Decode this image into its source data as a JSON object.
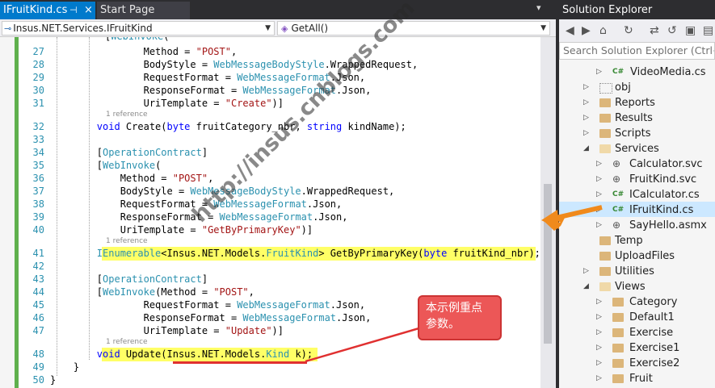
{
  "tabs": [
    {
      "label": "IFruitKind.cs",
      "active": true
    },
    {
      "label": "Start Page",
      "active": false
    }
  ],
  "nav": {
    "left_combo": "Insus.NET.Services.IFruitKind",
    "right_combo": "GetAll()"
  },
  "code_lines": [
    {
      "n": "27"
    },
    {
      "n": "28"
    },
    {
      "n": "29"
    },
    {
      "n": "30"
    },
    {
      "n": "31"
    },
    {
      "n": "32"
    },
    {
      "n": "33"
    },
    {
      "n": "34"
    },
    {
      "n": "35"
    },
    {
      "n": "36"
    },
    {
      "n": "37"
    },
    {
      "n": "38"
    },
    {
      "n": "39"
    },
    {
      "n": "40"
    },
    {
      "n": "41"
    },
    {
      "n": "42"
    },
    {
      "n": "43"
    },
    {
      "n": "44"
    },
    {
      "n": "45"
    },
    {
      "n": "46"
    },
    {
      "n": "47"
    },
    {
      "n": "48"
    },
    {
      "n": "49"
    },
    {
      "n": "50"
    }
  ],
  "reference_label": "1 reference",
  "solution_explorer": {
    "title": "Solution Explorer",
    "search_placeholder": "Search Solution Explorer (Ctrl+;)",
    "items": [
      {
        "label": "VideoMedia.cs"
      },
      {
        "label": "obj"
      },
      {
        "label": "Reports"
      },
      {
        "label": "Results"
      },
      {
        "label": "Scripts"
      },
      {
        "label": "Services"
      },
      {
        "label": "Calculator.svc"
      },
      {
        "label": "FruitKind.svc"
      },
      {
        "label": "ICalculator.cs"
      },
      {
        "label": "IFruitKind.cs"
      },
      {
        "label": "SayHello.asmx"
      },
      {
        "label": "Temp"
      },
      {
        "label": "UploadFiles"
      },
      {
        "label": "Utilities"
      },
      {
        "label": "Views"
      },
      {
        "label": "Category"
      },
      {
        "label": "Default1"
      },
      {
        "label": "Exercise"
      },
      {
        "label": "Exercise1"
      },
      {
        "label": "Exercise2"
      },
      {
        "label": "Fruit"
      }
    ]
  },
  "annotation": {
    "callout_line1": "本示例重点",
    "callout_line2": "参数。"
  },
  "watermark": "http://insus.cnblogs.com",
  "colors": {
    "accent": "#007acc",
    "highlight": "#ffff66",
    "callout": "#ec5757",
    "arrow": "#f08a1c",
    "underline": "#e03030"
  }
}
